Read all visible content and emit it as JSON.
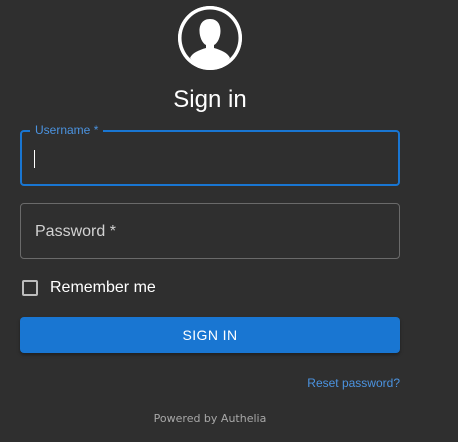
{
  "header": {
    "avatar_icon": "user-avatar-icon",
    "title": "Sign in"
  },
  "form": {
    "username_label": "Username *",
    "username_value": "",
    "password_placeholder": "Password *",
    "remember_label": "Remember me",
    "remember_checked": false,
    "submit_label": "SIGN IN",
    "reset_label": "Reset password?"
  },
  "footer": {
    "powered_by": "Powered by Authelia"
  },
  "colors": {
    "background": "#2f2f2f",
    "accent": "#1976d2",
    "link": "#4b93e0"
  }
}
